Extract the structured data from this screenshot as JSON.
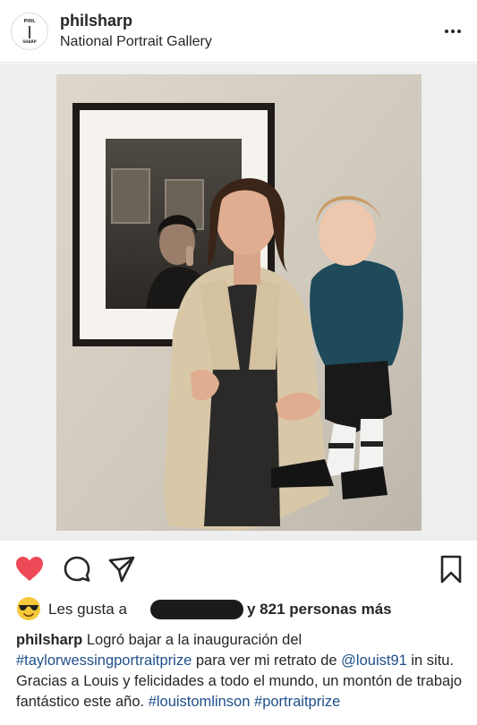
{
  "post": {
    "username": "philsharp",
    "location": "National Portrait Gallery",
    "avatar_top_text": "PHIL",
    "avatar_bottom_text": "SHARP"
  },
  "actions": {
    "like_icon": "heart-filled-icon",
    "comment_icon": "comment-icon",
    "share_icon": "direct-share-icon",
    "save_icon": "bookmark-icon",
    "like_color": "#ed4956"
  },
  "likes": {
    "emoji_icon": "sunglasses-emoji-icon",
    "prefix": "Les gusta a",
    "suffix": "y 821 personas más"
  },
  "caption": {
    "username": "philsharp",
    "text1": " Logró bajar a la inauguración del ",
    "tag1": "#taylorwessingportraitprize",
    "text2": " para ver mi retrato de ",
    "tag2": "@louist91",
    "text3": " in situ. Gracias a Louis y felicidades a todo el mundo, un montón de trabajo fantástico este año. ",
    "tag3": "#louistomlinson",
    "text4": " ",
    "tag4": "#portraitprize"
  },
  "colors": {
    "link": "#1f4f8a",
    "text": "#262626"
  }
}
